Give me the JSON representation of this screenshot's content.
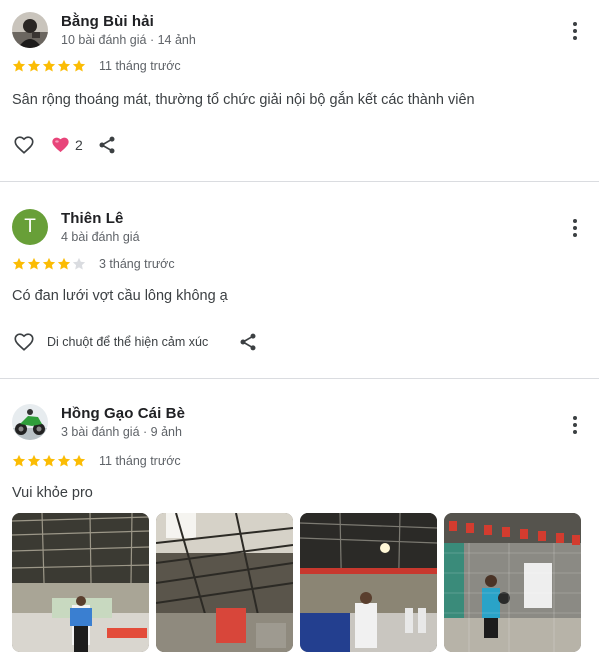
{
  "reviews": [
    {
      "author": "Bằng Bùi hải",
      "meta": "10 bài đánh giá · 14 ảnh",
      "stars": 5,
      "time": "11 tháng trước",
      "text": "Sân rộng thoáng mát, thường tổ chức giải nội bộ gắn kết các thành viên",
      "reaction_count": "2",
      "avatar_icon": "photo-avatar"
    },
    {
      "author": "Thiên Lê",
      "meta": "4 bài đánh giá",
      "stars": 4,
      "time": "3 tháng trước",
      "text": "Có đan lưới vợt cầu lông không ạ",
      "hover_hint": "Di chuột để thể hiện cảm xúc",
      "avatar_letter": "T",
      "avatar_color": "#689f38"
    },
    {
      "author": "Hồng Gạo Cái Bè",
      "meta": "3 bài đánh giá · 9 ảnh",
      "stars": 5,
      "time": "11 tháng trước",
      "text": "Vui khỏe pro",
      "avatar_icon": "motorbike-avatar",
      "photo_count": 4
    }
  ],
  "colors": {
    "star_filled": "#fbbc04",
    "star_empty": "#dadce0",
    "reaction_heart": "#e8457a",
    "divider": "#dadce0"
  }
}
